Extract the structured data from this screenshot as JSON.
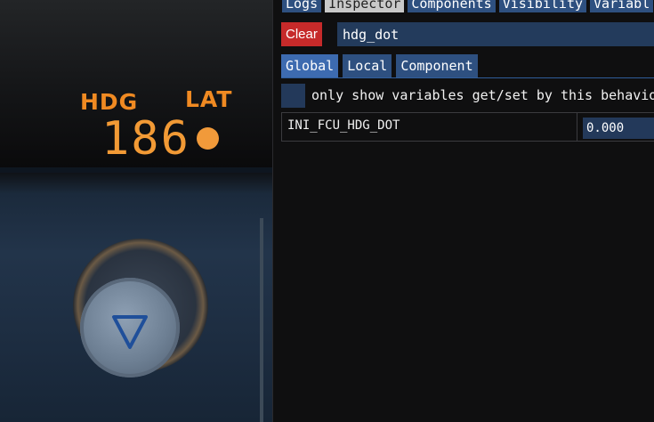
{
  "cockpit": {
    "hdg_label": "HDG",
    "lat_label": "LAT",
    "heading_value": "186"
  },
  "panel": {
    "tabs": [
      {
        "label": "Logs",
        "active": false
      },
      {
        "label": "Inspector",
        "active": true
      },
      {
        "label": "Components",
        "active": false
      },
      {
        "label": "Visibility",
        "active": false
      },
      {
        "label": "Variabl",
        "active": false
      }
    ],
    "clear_label": "Clear",
    "search_value": "hdg_dot",
    "subtabs": [
      {
        "label": "Global",
        "active": true
      },
      {
        "label": "Local",
        "active": false
      },
      {
        "label": "Component",
        "active": false
      }
    ],
    "filter_label": "only show variables get/set by this behavior",
    "variables": [
      {
        "name": "INI_FCU_HDG_DOT",
        "value": "0.000"
      }
    ]
  },
  "colors": {
    "display_orange": "#f08a22",
    "tab_blue": "#2e5080",
    "tab_active": "#c9c9c9",
    "clear_red": "#c62a2a",
    "field_blue": "#233b5c"
  }
}
